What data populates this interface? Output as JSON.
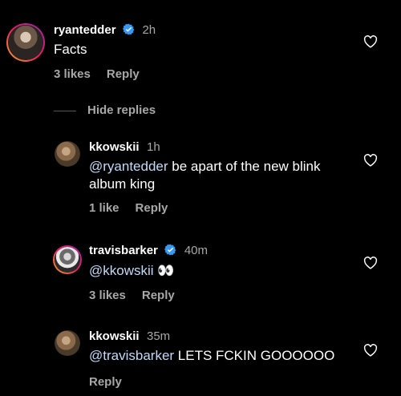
{
  "colors": {
    "background": "#000000",
    "text": "#ffffff",
    "muted": "#a8a8a8",
    "mention": "#c3d9f7",
    "verified": "#3897f0"
  },
  "comments": [
    {
      "username": "ryantedder",
      "verified": true,
      "time": "2h",
      "text": "Facts",
      "likes": "3 likes",
      "reply": "Reply"
    },
    {
      "username": "kkowskii",
      "verified": false,
      "time": "1h",
      "mention": "@ryantedder",
      "text_line1": " be apart of the new blink",
      "text_line2": "album king",
      "likes": "1 like",
      "reply": "Reply"
    },
    {
      "username": "travisbarker",
      "verified": true,
      "time": "40m",
      "mention": "@kkowskii",
      "emoji": "👀",
      "likes": "3 likes",
      "reply": "Reply"
    },
    {
      "username": "kkowskii",
      "verified": false,
      "time": "35m",
      "mention": "@travisbarker",
      "text": " LETS FCKIN GOOOOOO",
      "reply": "Reply"
    }
  ],
  "hide_replies_label": "Hide replies",
  "icons": [
    "verified-badge-icon",
    "heart-icon"
  ]
}
